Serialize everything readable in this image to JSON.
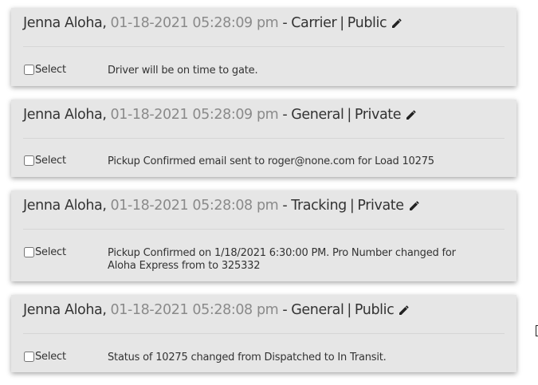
{
  "notes": [
    {
      "author": "Jenna Aloha",
      "timestamp": "01-18-2021 05:28:09 pm",
      "category": "Carrier",
      "visibility": "Public",
      "select_label": "Select",
      "text": "Driver will be on time to gate."
    },
    {
      "author": "Jenna Aloha",
      "timestamp": "01-18-2021 05:28:09 pm",
      "category": "General",
      "visibility": "Private",
      "select_label": "Select",
      "text": "Pickup Confirmed email sent to roger@none.com for Load 10275"
    },
    {
      "author": "Jenna Aloha",
      "timestamp": "01-18-2021 05:28:08 pm",
      "category": "Tracking",
      "visibility": "Private",
      "select_label": "Select",
      "text": "Pickup Confirmed on 1/18/2021 6:30:00 PM. Pro Number changed for Aloha Express from to 325332"
    },
    {
      "author": "Jenna Aloha",
      "timestamp": "01-18-2021 05:28:08 pm",
      "category": "General",
      "visibility": "Public",
      "select_label": "Select",
      "text": "Status of 10275 changed from Dispatched to In Transit."
    }
  ],
  "separators": {
    "comma": ",",
    "dash": "-",
    "pipe": "|"
  },
  "icons": {
    "edit": "pencil-icon"
  },
  "colors": {
    "card_background": "#e6e6e6",
    "timestamp": "#8a8a8a",
    "text": "#333333"
  }
}
